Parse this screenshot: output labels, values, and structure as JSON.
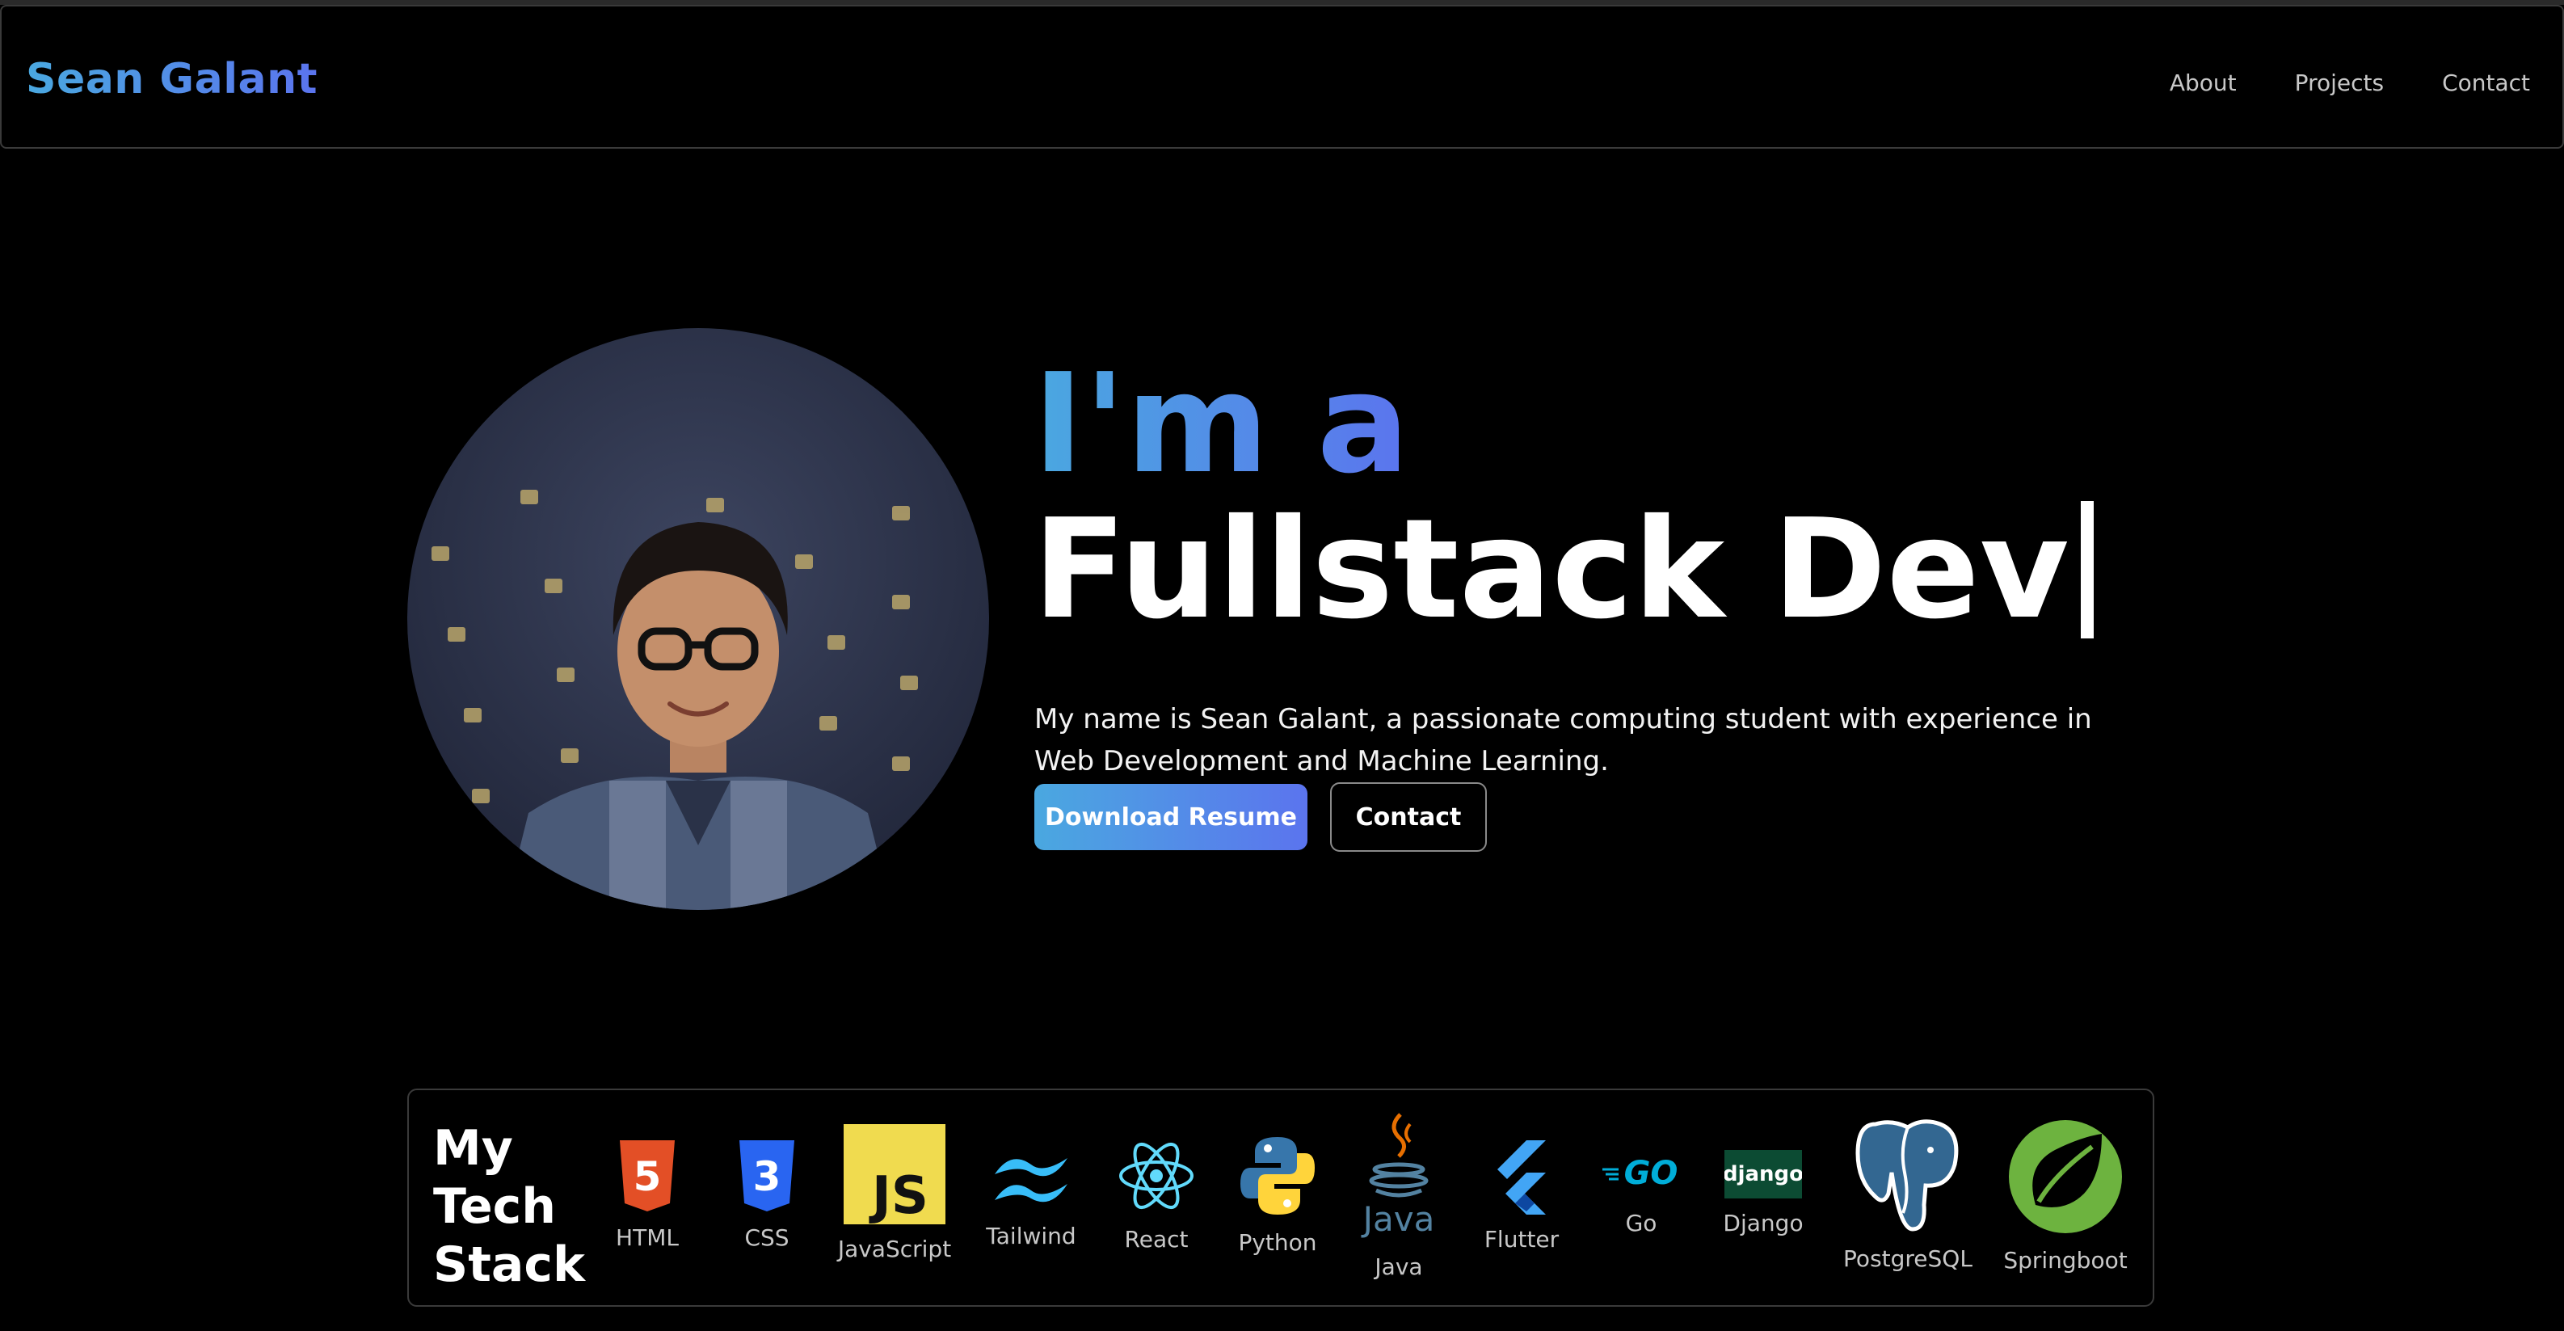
{
  "nav": {
    "brand": "Sean Galant",
    "links": [
      "About",
      "Projects",
      "Contact"
    ]
  },
  "hero": {
    "line1": "I'm a",
    "line2": "Fullstack Dev",
    "description": "My name is Sean Galant, a passionate computing student with experience in Web Development and Machine Learning.",
    "primary_button": "Download Resume",
    "secondary_button": "Contact"
  },
  "tech_stack": {
    "title_lines": [
      "My",
      "Tech",
      "Stack"
    ],
    "items": [
      {
        "label": "HTML",
        "icon": "html5-icon",
        "color": "#e34f26"
      },
      {
        "label": "CSS",
        "icon": "css3-icon",
        "color": "#2965f1"
      },
      {
        "label": "JavaScript",
        "icon": "javascript-icon",
        "color": "#f0db4f"
      },
      {
        "label": "Tailwind",
        "icon": "tailwind-icon",
        "color": "#38bdf8"
      },
      {
        "label": "React",
        "icon": "react-icon",
        "color": "#61dafb"
      },
      {
        "label": "Python",
        "icon": "python-icon",
        "color": "#3776ab"
      },
      {
        "label": "Java",
        "icon": "java-icon",
        "color": "#e76f00"
      },
      {
        "label": "Flutter",
        "icon": "flutter-icon",
        "color": "#42a5f5"
      },
      {
        "label": "Go",
        "icon": "go-icon",
        "color": "#00add8"
      },
      {
        "label": "Django",
        "icon": "django-icon",
        "color": "#0c4b33"
      },
      {
        "label": "PostgreSQL",
        "icon": "postgresql-icon",
        "color": "#336791"
      },
      {
        "label": "Springboot",
        "icon": "springboot-icon",
        "color": "#6db33f"
      }
    ],
    "icon_text": {
      "html": "5",
      "css": "3",
      "js": "JS",
      "java": "Java",
      "go": "GO",
      "django": "django"
    }
  },
  "colors": {
    "accent_start": "#4aa8e0",
    "accent_end": "#5b74ee",
    "background": "#000000"
  }
}
